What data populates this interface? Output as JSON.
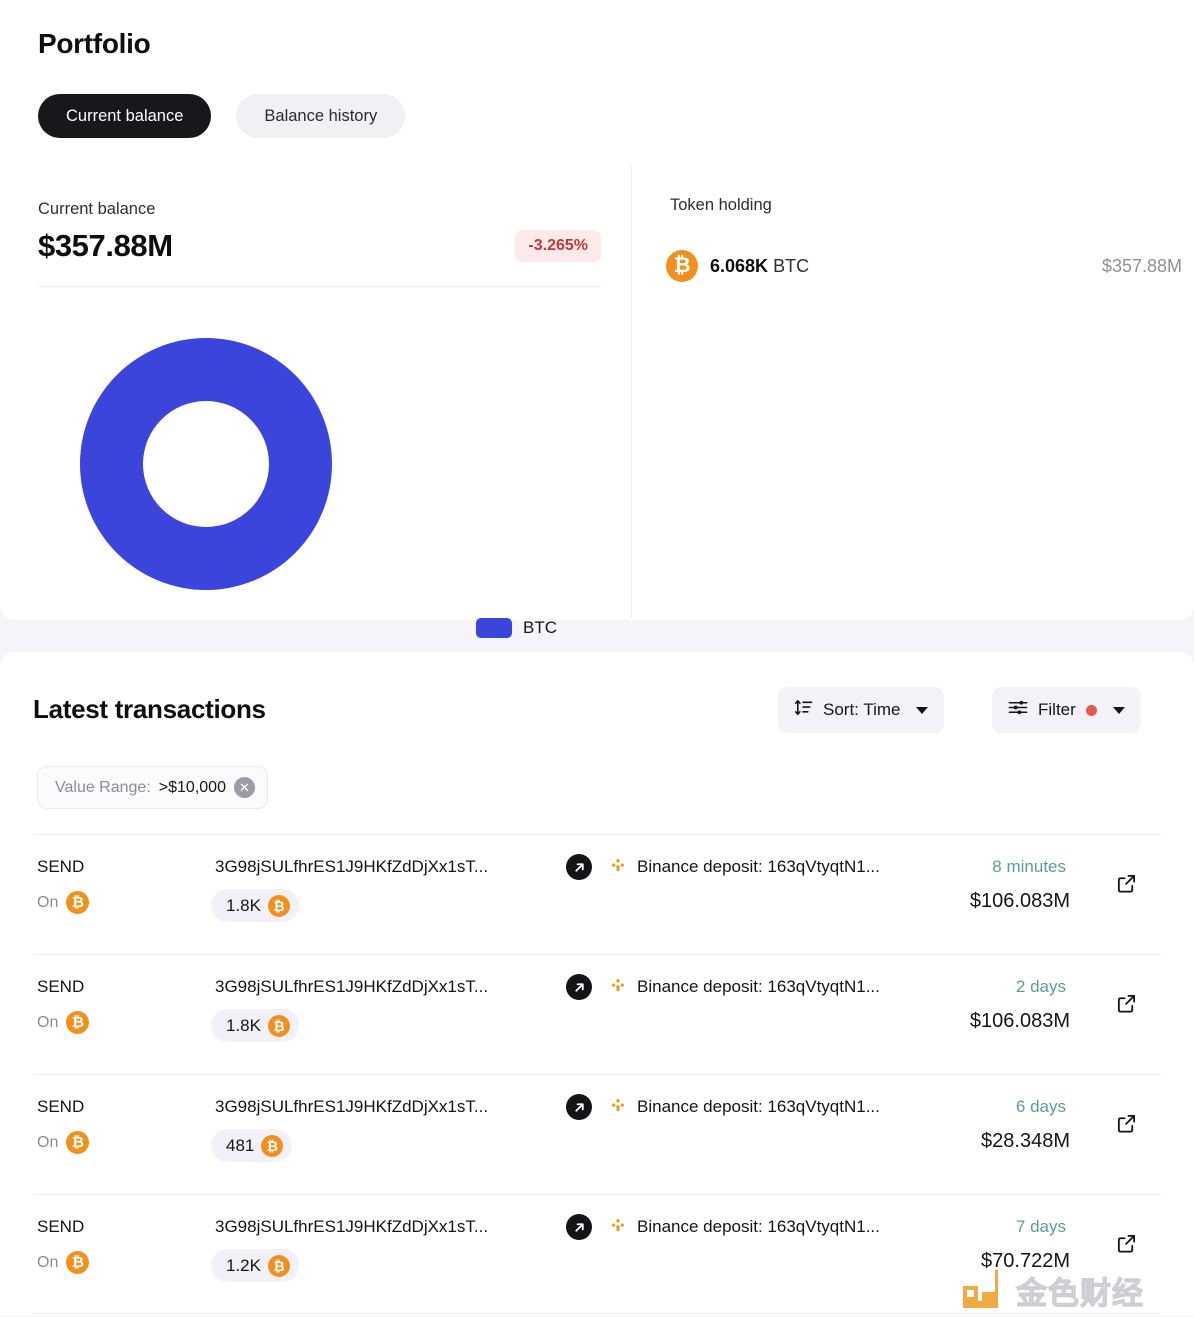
{
  "page": {
    "title": "Portfolio",
    "background_color": "#f4f4f9",
    "accent_color": "#3b45dc"
  },
  "tabs": [
    {
      "label": "Current balance",
      "active": true
    },
    {
      "label": "Balance history",
      "active": false
    }
  ],
  "balance_panel": {
    "label": "Current balance",
    "amount": "$357.88M",
    "change": "-3.265%",
    "change_color": "#c4363b"
  },
  "chart_data": {
    "type": "pie",
    "title": "",
    "variant": "donut",
    "categories": [
      "BTC"
    ],
    "values": [
      100
    ],
    "value_unit": "%",
    "colors": [
      "#3b45dc"
    ],
    "legend": [
      {
        "label": "BTC",
        "color": "#3b45dc"
      }
    ],
    "legend_position": "right",
    "total_value": "$357.88M"
  },
  "token_holding": {
    "label": "Token holding",
    "rows": [
      {
        "icon": "bitcoin-icon",
        "glyph": "₿",
        "amount": "6.068K",
        "symbol": "BTC",
        "value": "$357.88M"
      }
    ]
  },
  "transactions": {
    "title": "Latest transactions",
    "sort": {
      "label": "Sort: Time",
      "icon": "sort-icon"
    },
    "filter": {
      "label": "Filter",
      "icon": "filter-icon",
      "dot_color": "#e8584f",
      "has_active_filter": true
    },
    "chips": [
      {
        "key": "Value Range:",
        "value": ">$10,000",
        "removable": true
      }
    ],
    "rows": [
      {
        "type": "SEND",
        "on_label": "On",
        "chain_glyph": "₿",
        "from_address": "3G98jSULfhrES1J9HKfZdDjXx1sT...",
        "destination": "Binance deposit: 163qVtyqtN1...",
        "amount": "1.8K",
        "amount_glyph": "₿",
        "time": "8 minutes",
        "usd_value": "$106.083M"
      },
      {
        "type": "SEND",
        "on_label": "On",
        "chain_glyph": "₿",
        "from_address": "3G98jSULfhrES1J9HKfZdDjXx1sT...",
        "destination": "Binance deposit: 163qVtyqtN1...",
        "amount": "1.8K",
        "amount_glyph": "₿",
        "time": "2 days",
        "usd_value": "$106.083M"
      },
      {
        "type": "SEND",
        "on_label": "On",
        "chain_glyph": "₿",
        "from_address": "3G98jSULfhrES1J9HKfZdDjXx1sT...",
        "destination": "Binance deposit: 163qVtyqtN1...",
        "amount": "481",
        "amount_glyph": "₿",
        "time": "6 days",
        "usd_value": "$28.348M"
      },
      {
        "type": "SEND",
        "on_label": "On",
        "chain_glyph": "₿",
        "from_address": "3G98jSULfhrES1J9HKfZdDjXx1sT...",
        "destination": "Binance deposit: 163qVtyqtN1...",
        "amount": "1.2K",
        "amount_glyph": "₿",
        "time": "7 days",
        "usd_value": "$70.722M"
      }
    ]
  },
  "watermark": {
    "text": "金色财经"
  }
}
